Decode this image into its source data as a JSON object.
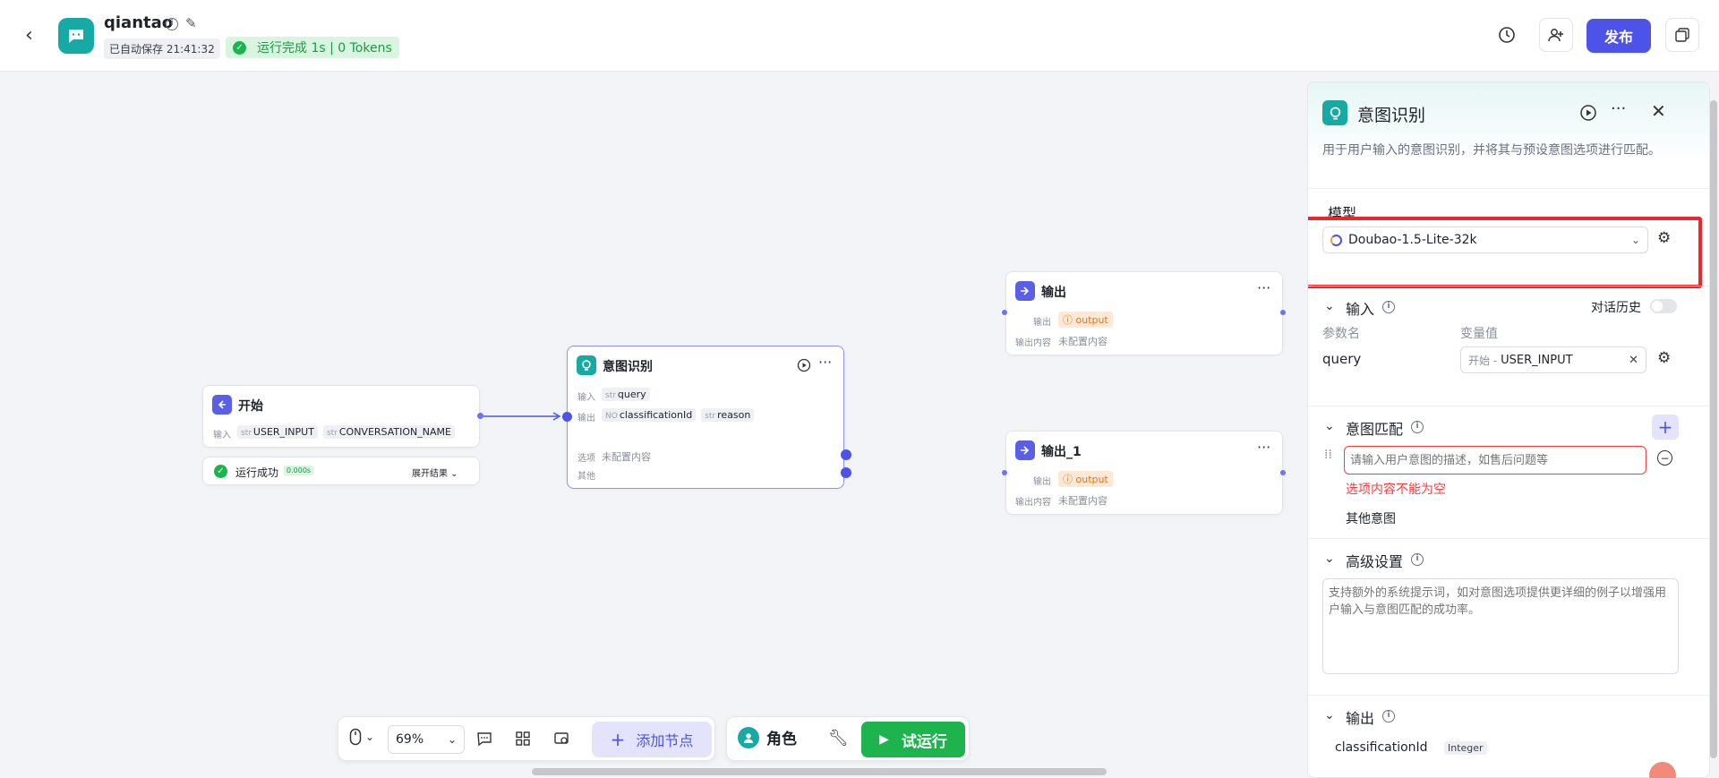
{
  "header": {
    "app_name": "qiantao",
    "autosave": "已自动保存 21:41:32",
    "run_status": "运行完成 1s | 0 Tokens",
    "publish_label": "发布"
  },
  "nodes": {
    "start": {
      "title": "开始",
      "input_label": "输入",
      "vars": [
        {
          "type": "str",
          "name": "USER_INPUT"
        },
        {
          "type": "str",
          "name": "CONVERSATION_NAME"
        }
      ],
      "run_result": "运行成功",
      "run_time": "0.000s",
      "expand_label": "展开结果"
    },
    "intent": {
      "title": "意图识别",
      "input_label": "输入",
      "input_var": {
        "type": "str",
        "name": "query"
      },
      "output_label": "输出",
      "outputs": [
        {
          "type": "NO",
          "name": "classificationId"
        },
        {
          "type": "str",
          "name": "reason"
        }
      ],
      "option_label": "选项",
      "option_value": "未配置内容",
      "other_label": "其他"
    },
    "output1": {
      "title": "输出",
      "output_label": "输出",
      "output_tag": "output",
      "content_label": "输出内容",
      "content_value": "未配置内容"
    },
    "output2": {
      "title": "输出_1",
      "output_label": "输出",
      "output_tag": "output",
      "content_label": "输出内容",
      "content_value": "未配置内容"
    }
  },
  "toolbar": {
    "zoom": "69%",
    "add_node": "添加节点",
    "role": "角色",
    "test_run": "试运行"
  },
  "panel": {
    "title": "意图识别",
    "description": "用于用户输入的意图识别，并将其与预设意图选项进行匹配。",
    "model_label": "模型",
    "model_value": "Doubao-1.5-Lite-32k",
    "input_section": "输入",
    "history_label": "对话历史",
    "param_name_col": "参数名",
    "var_value_col": "变量值",
    "param_name": "query",
    "var_source": "开始 -",
    "var_name": "USER_INPUT",
    "intent_section": "意图匹配",
    "intent_placeholder": "请输入用户意图的描述，如售后问题等",
    "intent_error": "选项内容不能为空",
    "other_intent": "其他意图",
    "advanced_section": "高级设置",
    "advanced_placeholder": "支持额外的系统提示词，如对意图选项提供更详细的例子以增强用户输入与意图匹配的成功率。",
    "output_section": "输出",
    "output_var": "classificationId",
    "output_type": "Integer"
  },
  "colors": {
    "accent": "#4d53e8",
    "brand_teal": "#17a9a3",
    "run_green": "#1db44e",
    "error_red": "#f53f3f",
    "highlight_red": "#e8282a"
  }
}
